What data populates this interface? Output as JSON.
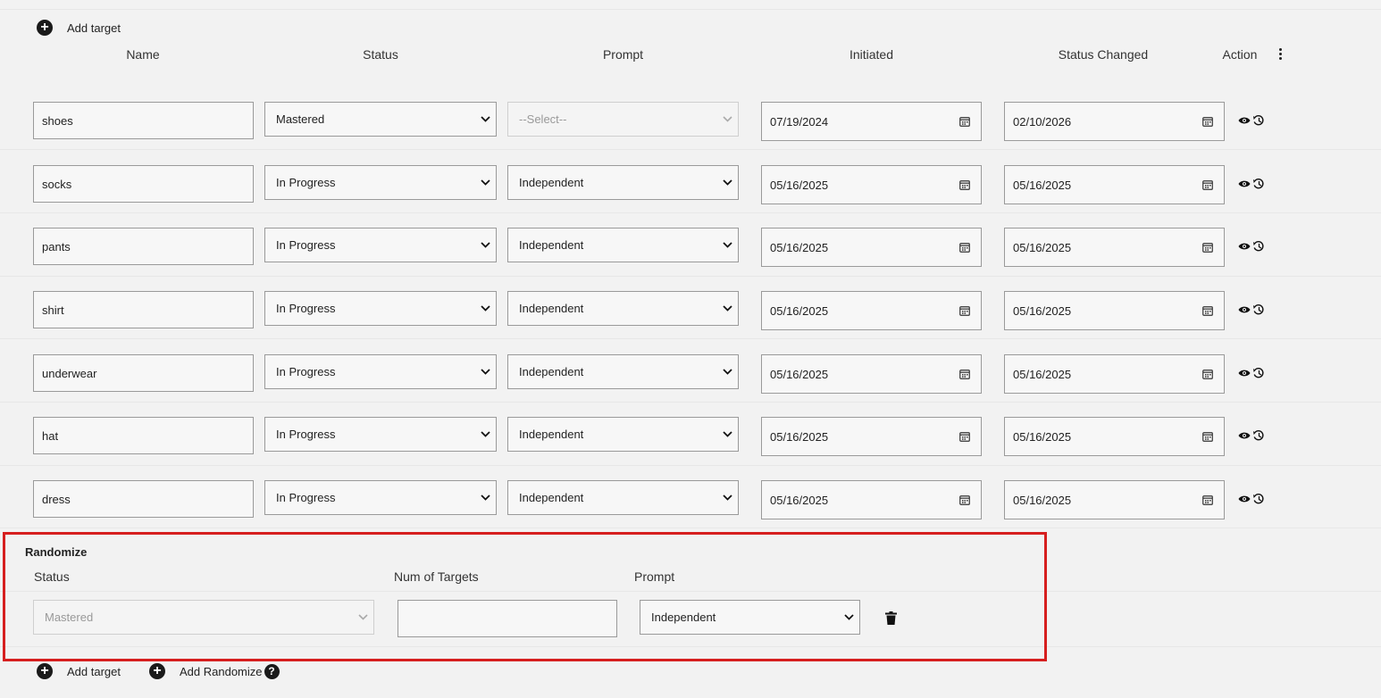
{
  "add_target_label": "Add target",
  "add_randomize_label": "Add Randomize",
  "columns": [
    "Name",
    "Status",
    "Prompt",
    "Initiated",
    "Status Changed",
    "Action"
  ],
  "targets": [
    {
      "name": "shoes",
      "status": "Mastered",
      "prompt": "--Select--",
      "initiated": "07/19/2024",
      "status_changed": "02/10/2026"
    },
    {
      "name": "socks",
      "status": "In Progress",
      "prompt": "Independent",
      "initiated": "05/16/2025",
      "status_changed": "05/16/2025"
    },
    {
      "name": "pants",
      "status": "In Progress",
      "prompt": "Independent",
      "initiated": "05/16/2025",
      "status_changed": "05/16/2025"
    },
    {
      "name": "shirt",
      "status": "In Progress",
      "prompt": "Independent",
      "initiated": "05/16/2025",
      "status_changed": "05/16/2025"
    },
    {
      "name": "underwear",
      "status": "In Progress",
      "prompt": "Independent",
      "initiated": "05/16/2025",
      "status_changed": "05/16/2025"
    },
    {
      "name": "hat",
      "status": "In Progress",
      "prompt": "Independent",
      "initiated": "05/16/2025",
      "status_changed": "05/16/2025"
    },
    {
      "name": "dress",
      "status": "In Progress",
      "prompt": "Independent",
      "initiated": "05/16/2025",
      "status_changed": "05/16/2025"
    }
  ],
  "randomize": {
    "title": "Randomize",
    "status_label": "Status",
    "num_targets_label": "Num of Targets",
    "prompt_label": "Prompt",
    "status_value": "Mastered",
    "num_targets_value": "",
    "prompt_value": "Independent"
  },
  "colors": {
    "highlight_border": "#d61f1f",
    "icon": "#1a1a1a"
  },
  "icons": [
    "plus-circle-icon",
    "kebab-menu-icon",
    "chevron-down-icon",
    "calendar-icon",
    "eye-icon",
    "history-icon",
    "trash-icon",
    "question-circle-icon"
  ]
}
